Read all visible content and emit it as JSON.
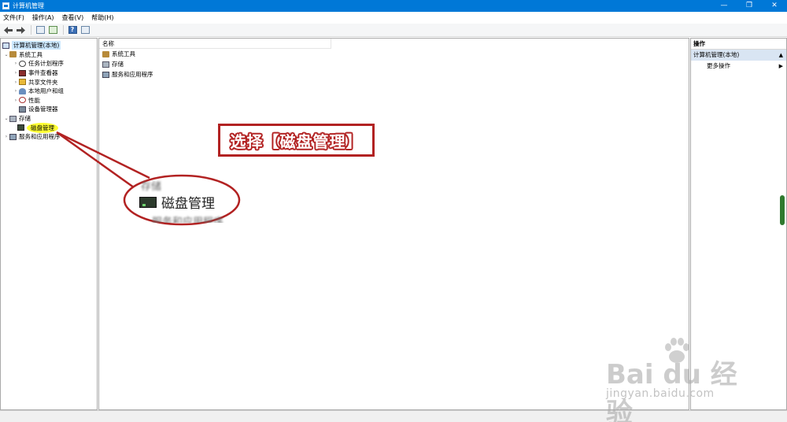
{
  "window": {
    "title": "计算机管理"
  },
  "window_controls": {
    "minimize": "—",
    "restore": "❐",
    "close": "✕"
  },
  "menu": [
    "文件(F)",
    "操作(A)",
    "查看(V)",
    "帮助(H)"
  ],
  "toolbar": {
    "help_glyph": "?"
  },
  "tree": {
    "root": "计算机管理(本地)",
    "system_tools": "系统工具",
    "task_scheduler": "任务计划程序",
    "event_viewer": "事件查看器",
    "shared_folders": "共享文件夹",
    "local_users": "本地用户和组",
    "performance": "性能",
    "device_manager": "设备管理器",
    "storage": "存储",
    "disk_management": "磁盘管理",
    "services_apps": "服务和应用程序"
  },
  "list": {
    "column_name": "名称",
    "items": [
      "系统工具",
      "存储",
      "服务和应用程序"
    ]
  },
  "actions": {
    "header": "操作",
    "section": "计算机管理(本地)",
    "more": "更多操作"
  },
  "annotation": {
    "callout_text": "选择【磁盘管理】",
    "zoom_label": "磁盘管理",
    "zoom_ghost_top": "存储",
    "zoom_ghost_bottom": "服务和应用程序",
    "accent_color": "#b22222",
    "highlight_color": "#ffff33"
  },
  "watermark": {
    "logo": "Bai du 经验",
    "url": "jingyan.baidu.com"
  },
  "colors": {
    "titlebar": "#0078d7",
    "selection": "#cce8ff",
    "action_section": "#d9e5f3"
  }
}
